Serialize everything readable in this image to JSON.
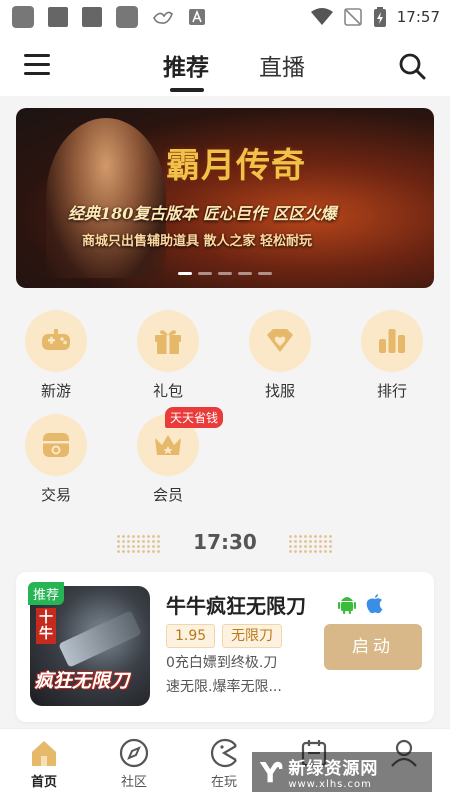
{
  "status_bar": {
    "time": "17:57"
  },
  "header": {
    "tabs": [
      {
        "label": "推荐",
        "active": true
      },
      {
        "label": "直播",
        "active": false
      }
    ]
  },
  "banner": {
    "title": "霸月传奇",
    "subtitle": "经典180复古版本 匠心巨作 区区火爆",
    "subtitle2": "商城只出售辅助道具 散人之家 轻松耐玩"
  },
  "categories": [
    {
      "label": "新游",
      "icon": "gamepad-icon"
    },
    {
      "label": "礼包",
      "icon": "gift-icon"
    },
    {
      "label": "找服",
      "icon": "heart-diamond-icon"
    },
    {
      "label": "排行",
      "icon": "bar-chart-icon"
    },
    {
      "label": "交易",
      "icon": "trade-box-icon"
    },
    {
      "label": "会员",
      "icon": "crown-icon",
      "badge": "天天省钱"
    }
  ],
  "schedule": {
    "time": "17:30"
  },
  "game_card": {
    "tag": "推荐",
    "thumb_logo": "疯狂无限刀",
    "thumb_mini": "十牛",
    "name": "牛牛疯狂无限刀",
    "badges": [
      "1.95",
      "无限刀"
    ],
    "desc_line1": "0充白嫖到终极.刀",
    "desc_line2": "速无限.爆率无限...",
    "launch_label": "启动"
  },
  "bottom_nav": [
    {
      "label": "首页",
      "active": true
    },
    {
      "label": "社区",
      "active": false
    },
    {
      "label": "在玩",
      "active": false
    },
    {
      "label": "",
      "active": false
    },
    {
      "label": "",
      "active": false
    }
  ],
  "watermark": {
    "text": "新绿资源网",
    "url": "www.xlhs.com"
  },
  "colors": {
    "accent": "#d8b888",
    "icon_bg": "#fbe8c9",
    "icon_fg": "#e6b86a",
    "badge_red": "#ea3b3b",
    "tag_green": "#27b455"
  }
}
